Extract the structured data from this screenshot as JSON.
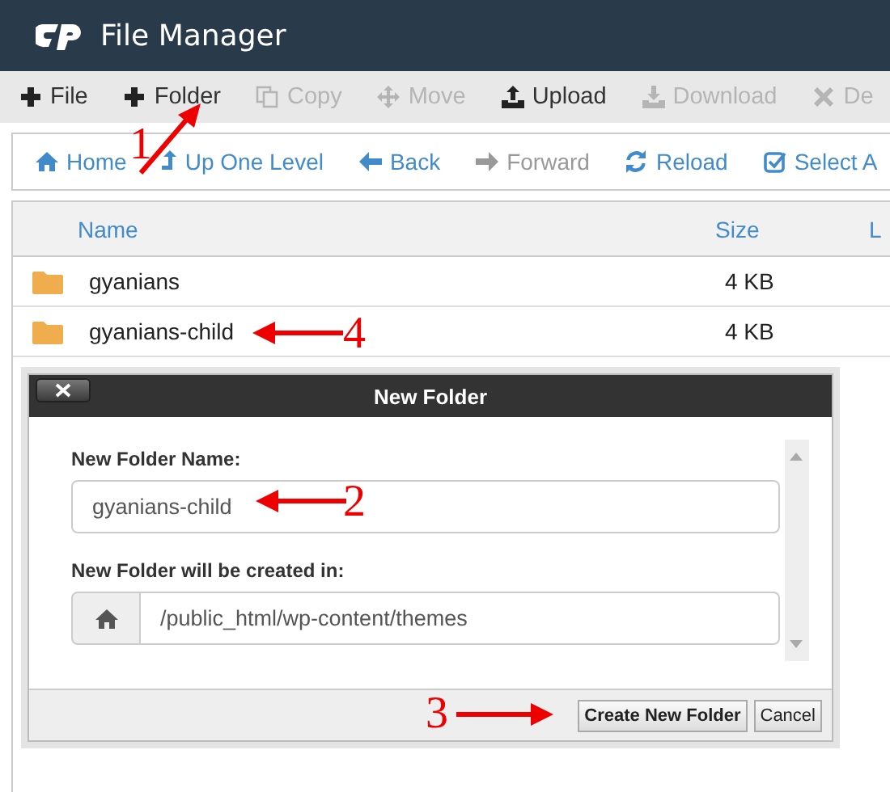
{
  "app": {
    "title": "File Manager"
  },
  "toolbar": [
    {
      "label": "File",
      "kind": "plus",
      "disabled": false
    },
    {
      "label": "Folder",
      "kind": "plus",
      "disabled": false
    },
    {
      "label": "Copy",
      "kind": "copy",
      "disabled": true
    },
    {
      "label": "Move",
      "kind": "move",
      "disabled": true
    },
    {
      "label": "Upload",
      "kind": "upload",
      "disabled": false
    },
    {
      "label": "Download",
      "kind": "download",
      "disabled": true
    },
    {
      "label": "De",
      "kind": "cross",
      "disabled": true
    }
  ],
  "navigation": [
    {
      "label": "Home",
      "kind": "home",
      "disabled": false
    },
    {
      "label": "Up One Level",
      "kind": "up",
      "disabled": false
    },
    {
      "label": "Back",
      "kind": "back",
      "disabled": false
    },
    {
      "label": "Forward",
      "kind": "forward",
      "disabled": true
    },
    {
      "label": "Reload",
      "kind": "reload",
      "disabled": false
    },
    {
      "label": "Select A",
      "kind": "check",
      "disabled": false
    }
  ],
  "table": {
    "columns": [
      "Name",
      "Size",
      "L"
    ],
    "rows": [
      {
        "name": "gyanians",
        "size": "4 KB"
      },
      {
        "name": "gyanians-child",
        "size": "4 KB"
      }
    ]
  },
  "dialog": {
    "title": "New Folder",
    "fields": [
      {
        "label": "New Folder Name:",
        "value": "gyanians-child",
        "kind": "text"
      },
      {
        "label": "New Folder will be created in:",
        "value": "/public_html/wp-content/themes",
        "kind": "path"
      }
    ],
    "buttons": [
      {
        "label": "Create New Folder",
        "kind": "primary"
      },
      {
        "label": "Cancel",
        "kind": "secondary"
      }
    ]
  },
  "annotations": [
    {
      "label": "1",
      "kind": "up-right"
    },
    {
      "label": "4",
      "kind": "left"
    },
    {
      "label": "2",
      "kind": "left"
    },
    {
      "label": "3",
      "kind": "right"
    }
  ]
}
